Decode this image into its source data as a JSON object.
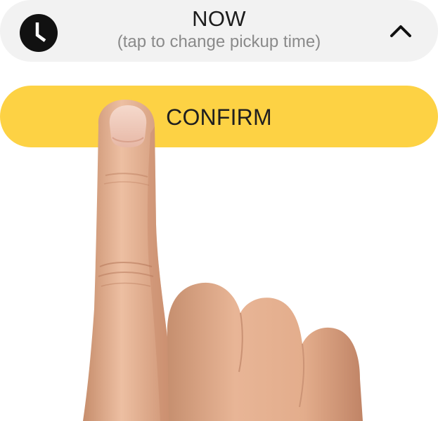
{
  "pickup": {
    "title": "NOW",
    "subtitle": "(tap to change pickup time)",
    "icon": "clock-icon",
    "expand_icon": "chevron-up-icon",
    "background": "#f2f2f2"
  },
  "confirm": {
    "label": "CONFIRM",
    "color": "#fdd244"
  }
}
